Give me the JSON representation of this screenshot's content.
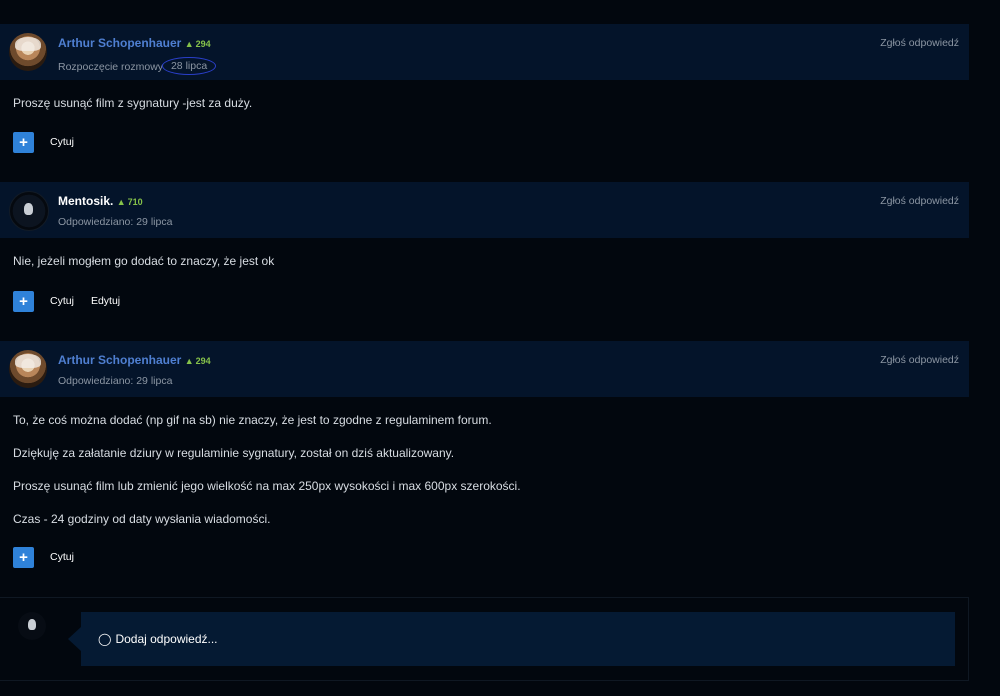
{
  "posts": [
    {
      "author": "Arthur Schopenhauer",
      "reputation": "294",
      "meta_prefix": "Rozpoczęcie rozmowy",
      "date": "28 lipca",
      "report": "Zgłoś odpowiedź",
      "body": [
        "Proszę usunąć film z sygnatury -jest za duży."
      ],
      "actions": [
        "Cytuj"
      ]
    },
    {
      "author": "Mentosik.",
      "reputation": "710",
      "meta": "Odpowiedziano: 29 lipca",
      "report": "Zgłoś odpowiedź",
      "body": [
        "Nie, jeżeli mogłem go dodać to znaczy, że jest ok"
      ],
      "actions": [
        "Cytuj",
        "Edytuj"
      ]
    },
    {
      "author": "Arthur Schopenhauer",
      "reputation": "294",
      "meta": "Odpowiedziano: 29 lipca",
      "report": "Zgłoś odpowiedź",
      "body": [
        "To, że coś można dodać (np gif na sb) nie znaczy, że jest to zgodne z regulaminem forum.",
        "Dziękuję za załatanie dziury w regulaminie sygnatury, został on dziś aktualizowany.",
        "Proszę usunąć film lub zmienić jego wielkość na max 250px wysokości i max 600px szerokości.",
        "Czas - 24 godziny od daty wysłania wiadomości."
      ],
      "actions": [
        "Cytuj"
      ]
    }
  ],
  "reply": {
    "placeholder": "Dodaj odpowiedź..."
  },
  "icons": {
    "plus": "+",
    "thumbs_up": "👍",
    "speech": "💬"
  },
  "colors": {
    "background": "#02070e",
    "header": "#04142a",
    "author_link": "#4f7fd1",
    "reputation": "#86c24a",
    "button": "#2f82d9",
    "circle_annotation": "#2a3fc9"
  }
}
